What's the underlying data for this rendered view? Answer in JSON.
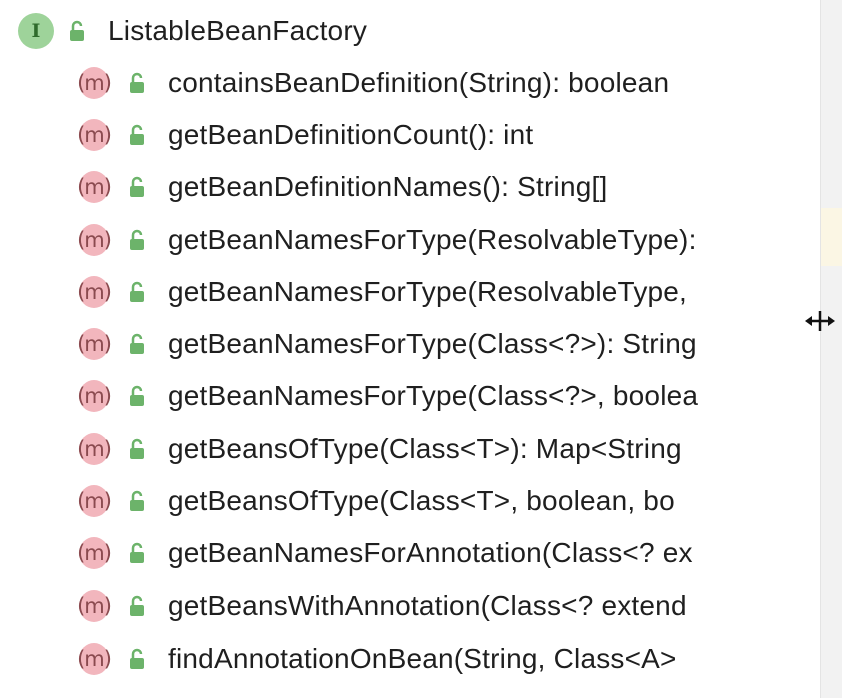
{
  "structure": {
    "interface": {
      "icon_letter": "I",
      "name": "ListableBeanFactory"
    },
    "method_icon_letter": "m",
    "methods": [
      {
        "label": "containsBeanDefinition(String): boolean"
      },
      {
        "label": "getBeanDefinitionCount(): int"
      },
      {
        "label": "getBeanDefinitionNames(): String[]"
      },
      {
        "label": "getBeanNamesForType(ResolvableType): "
      },
      {
        "label": "getBeanNamesForType(ResolvableType, "
      },
      {
        "label": "getBeanNamesForType(Class<?>): String"
      },
      {
        "label": "getBeanNamesForType(Class<?>, boolea"
      },
      {
        "label": "getBeansOfType(Class<T>): Map<String"
      },
      {
        "label": "getBeansOfType(Class<T>, boolean, bo"
      },
      {
        "label": "getBeanNamesForAnnotation(Class<? ex"
      },
      {
        "label": "getBeansWithAnnotation(Class<? extend"
      },
      {
        "label": "findAnnotationOnBean(String, Class<A>"
      }
    ]
  },
  "colors": {
    "interface_icon": "#9ed39a",
    "method_icon": "#f2b6bd",
    "public_lock": "#6cb36a",
    "text": "#1f1f1f"
  }
}
